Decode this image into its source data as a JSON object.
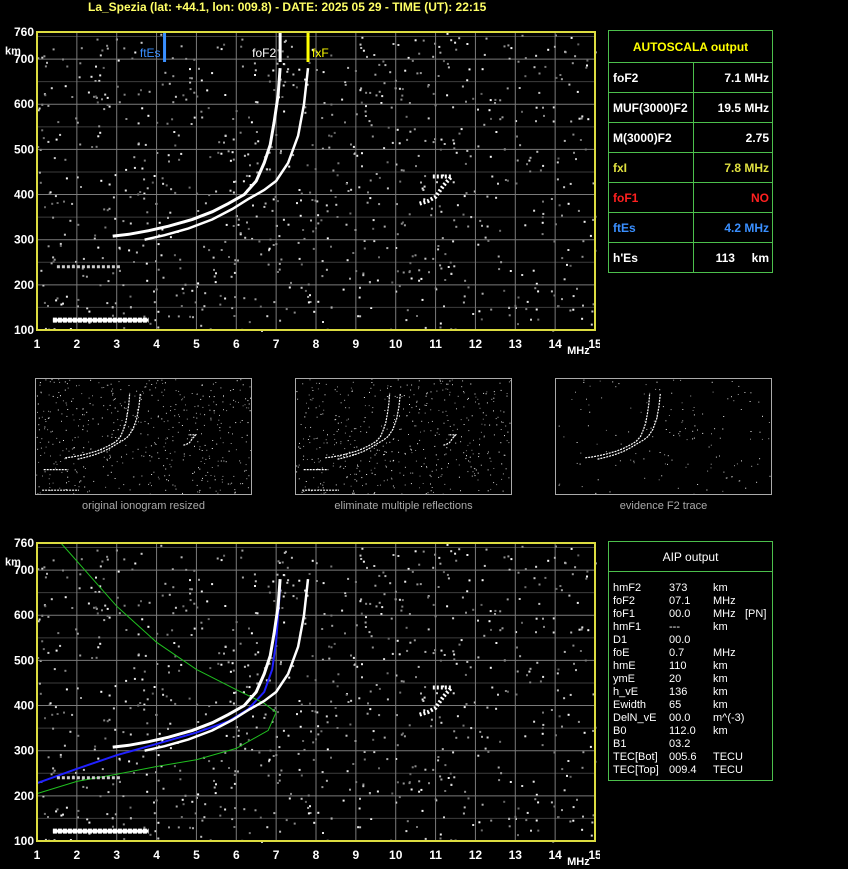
{
  "header": {
    "title": "La_Spezia (lat: +44.1, lon: 009.8) - DATE: 2025 05 29 - TIME (UT): 22:15"
  },
  "colors": {
    "grid": "#7a7a7a",
    "frame": "#dcdc40",
    "panel_border": "#4cbf4c",
    "foF2": "#ffffff",
    "fxF": "#ffff00",
    "ftEs": "#3a8fff",
    "label_yellow": "#ffff00",
    "label_red": "#ff2020",
    "label_blue": "#3a8fff",
    "aip_blue": "#2020ff",
    "aip_green": "#20c020"
  },
  "ionogram_top": {
    "y_unit": "km",
    "x_unit": "MHz",
    "markers": {
      "ftEs": "ftEs",
      "foF2": "foF2",
      "fxF": "fxF"
    }
  },
  "ionogram_bottom": {
    "y_unit": "km",
    "x_unit": "MHz"
  },
  "chart_data": [
    {
      "type": "scatter",
      "x_ticks": [
        1,
        2,
        3,
        4,
        5,
        6,
        7,
        8,
        9,
        10,
        11,
        12,
        13,
        14,
        15
      ],
      "y_ticks": [
        100,
        200,
        300,
        400,
        500,
        600,
        700,
        760
      ],
      "xlim": [
        1,
        15
      ],
      "ylim": [
        100,
        760
      ],
      "grid": true,
      "xlabel": "MHz",
      "ylabel": "km",
      "markers": [
        {
          "name": "ftEs",
          "x": 4.2
        },
        {
          "name": "foF2",
          "x": 7.1
        },
        {
          "name": "fxF",
          "x": 7.8
        }
      ],
      "series": [
        {
          "name": "o-trace",
          "points": [
            [
              2.9,
              308
            ],
            [
              3.3,
              312
            ],
            [
              3.8,
              320
            ],
            [
              4.3,
              330
            ],
            [
              4.9,
              345
            ],
            [
              5.4,
              362
            ],
            [
              5.8,
              380
            ],
            [
              6.2,
              400
            ],
            [
              6.5,
              430
            ],
            [
              6.7,
              470
            ],
            [
              6.85,
              510
            ],
            [
              6.95,
              560
            ],
            [
              7.05,
              620
            ],
            [
              7.1,
              680
            ]
          ]
        },
        {
          "name": "x-trace",
          "points": [
            [
              3.7,
              300
            ],
            [
              4.2,
              310
            ],
            [
              4.8,
              325
            ],
            [
              5.4,
              345
            ],
            [
              5.9,
              368
            ],
            [
              6.3,
              390
            ],
            [
              6.7,
              410
            ],
            [
              7.0,
              430
            ],
            [
              7.3,
              470
            ],
            [
              7.55,
              530
            ],
            [
              7.7,
              600
            ],
            [
              7.8,
              680
            ]
          ]
        },
        {
          "name": "Es-trace",
          "points": [
            [
              1.4,
              122
            ],
            [
              2.0,
              122
            ],
            [
              2.6,
              122
            ],
            [
              3.2,
              122
            ],
            [
              3.8,
              122
            ]
          ]
        },
        {
          "name": "Es-multiple",
          "points": [
            [
              1.5,
              240
            ],
            [
              2.1,
              240
            ],
            [
              2.7,
              240
            ],
            [
              3.1,
              240
            ]
          ]
        },
        {
          "name": "spread",
          "points": [
            [
              10.6,
              380
            ],
            [
              10.8,
              385
            ],
            [
              11.0,
              395
            ],
            [
              11.2,
              420
            ],
            [
              11.4,
              440
            ],
            [
              10.9,
              440
            ]
          ]
        }
      ]
    },
    {
      "type": "scatter",
      "x_ticks": [
        1,
        2,
        3,
        4,
        5,
        6,
        7,
        8,
        9,
        10,
        11,
        12,
        13,
        14,
        15
      ],
      "y_ticks": [
        100,
        200,
        300,
        400,
        500,
        600,
        700,
        760
      ],
      "xlim": [
        1,
        15
      ],
      "ylim": [
        100,
        760
      ],
      "grid": true,
      "xlabel": "MHz",
      "ylabel": "km",
      "series": [
        {
          "name": "profile-blue",
          "points": [
            [
              1.0,
              228
            ],
            [
              2.0,
              260
            ],
            [
              3.0,
              290
            ],
            [
              4.0,
              315
            ],
            [
              5.0,
              340
            ],
            [
              5.8,
              365
            ],
            [
              6.3,
              392
            ],
            [
              6.7,
              430
            ],
            [
              6.9,
              480
            ],
            [
              7.0,
              540
            ],
            [
              7.05,
              600
            ],
            [
              7.1,
              660
            ]
          ]
        },
        {
          "name": "profile-green-upper",
          "points": [
            [
              1.6,
              760
            ],
            [
              2.2,
              700
            ],
            [
              3.0,
              620
            ],
            [
              4.0,
              540
            ],
            [
              5.0,
              480
            ],
            [
              6.0,
              435
            ],
            [
              6.7,
              405
            ],
            [
              7.0,
              385
            ]
          ]
        },
        {
          "name": "profile-green-lower",
          "points": [
            [
              7.0,
              385
            ],
            [
              6.8,
              345
            ],
            [
              6.0,
              305
            ],
            [
              5.0,
              280
            ],
            [
              4.0,
              265
            ],
            [
              3.0,
              248
            ],
            [
              2.0,
              232
            ],
            [
              1.0,
              205
            ]
          ]
        },
        {
          "name": "o-trace",
          "points": [
            [
              2.9,
              308
            ],
            [
              3.3,
              312
            ],
            [
              3.8,
              320
            ],
            [
              4.3,
              330
            ],
            [
              4.9,
              345
            ],
            [
              5.4,
              362
            ],
            [
              5.8,
              380
            ],
            [
              6.2,
              400
            ],
            [
              6.5,
              430
            ],
            [
              6.7,
              470
            ],
            [
              6.85,
              510
            ],
            [
              6.95,
              560
            ],
            [
              7.05,
              620
            ],
            [
              7.1,
              680
            ]
          ]
        },
        {
          "name": "x-trace",
          "points": [
            [
              3.7,
              300
            ],
            [
              4.2,
              310
            ],
            [
              4.8,
              325
            ],
            [
              5.4,
              345
            ],
            [
              5.9,
              368
            ],
            [
              6.3,
              390
            ],
            [
              6.7,
              410
            ],
            [
              7.0,
              430
            ],
            [
              7.3,
              470
            ],
            [
              7.55,
              530
            ],
            [
              7.7,
              600
            ],
            [
              7.8,
              680
            ]
          ]
        },
        {
          "name": "Es-trace",
          "points": [
            [
              1.4,
              122
            ],
            [
              2.0,
              122
            ],
            [
              2.6,
              122
            ],
            [
              3.2,
              122
            ],
            [
              3.8,
              122
            ]
          ]
        },
        {
          "name": "Es-multiple",
          "points": [
            [
              1.5,
              240
            ],
            [
              2.1,
              240
            ],
            [
              2.7,
              240
            ],
            [
              3.1,
              240
            ]
          ]
        },
        {
          "name": "spread",
          "points": [
            [
              10.6,
              380
            ],
            [
              10.8,
              385
            ],
            [
              11.0,
              395
            ],
            [
              11.2,
              420
            ],
            [
              11.4,
              440
            ],
            [
              10.9,
              440
            ]
          ]
        }
      ]
    }
  ],
  "autoscala": {
    "title": "AUTOSCALA output",
    "rows": [
      {
        "label": "foF2",
        "value": "7.1 MHz",
        "color": "#ffffff"
      },
      {
        "label": "MUF(3000)F2",
        "value": "19.5 MHz",
        "color": "#ffffff"
      },
      {
        "label": "M(3000)F2",
        "value": "2.75",
        "color": "#ffffff"
      },
      {
        "label": "fxI",
        "value": "7.8 MHz",
        "color": "#e0e040"
      },
      {
        "label": "foF1",
        "value": "NO",
        "color": "#ff2020"
      },
      {
        "label": "ftEs",
        "value": "4.2 MHz",
        "color": "#3a8fff"
      },
      {
        "label": "h'Es",
        "value": "113     km",
        "color": "#ffffff"
      }
    ]
  },
  "thumbnails": {
    "captions": [
      "original ionogram resized",
      "eliminate multiple reflections",
      "evidence F2 trace"
    ]
  },
  "aip": {
    "title": "AIP output",
    "rows": [
      {
        "name": "hmF2",
        "value": "373",
        "unit": "km",
        "extra": ""
      },
      {
        "name": "foF2",
        "value": "07.1",
        "unit": "MHz",
        "extra": ""
      },
      {
        "name": "foF1",
        "value": "00.0",
        "unit": "MHz",
        "extra": "[PN]"
      },
      {
        "name": "hmF1",
        "value": "---",
        "unit": "km",
        "extra": ""
      },
      {
        "name": "D1",
        "value": "00.0",
        "unit": "",
        "extra": ""
      },
      {
        "name": "foE",
        "value": "0.7",
        "unit": "MHz",
        "extra": ""
      },
      {
        "name": "hmE",
        "value": "110",
        "unit": "km",
        "extra": ""
      },
      {
        "name": "ymE",
        "value": "20",
        "unit": "km",
        "extra": ""
      },
      {
        "name": "h_vE",
        "value": "136",
        "unit": "km",
        "extra": ""
      },
      {
        "name": "Ewidth",
        "value": "65",
        "unit": "km",
        "extra": ""
      },
      {
        "name": "DelN_vE",
        "value": "00.0",
        "unit": "m^(-3)",
        "extra": ""
      },
      {
        "name": "B0",
        "value": "112.0",
        "unit": "km",
        "extra": ""
      },
      {
        "name": "B1",
        "value": "03.2",
        "unit": "",
        "extra": ""
      },
      {
        "name": "TEC[Bot]",
        "value": "005.6",
        "unit": "TECU",
        "extra": ""
      },
      {
        "name": "TEC[Top]",
        "value": "009.4",
        "unit": "TECU",
        "extra": ""
      }
    ]
  }
}
